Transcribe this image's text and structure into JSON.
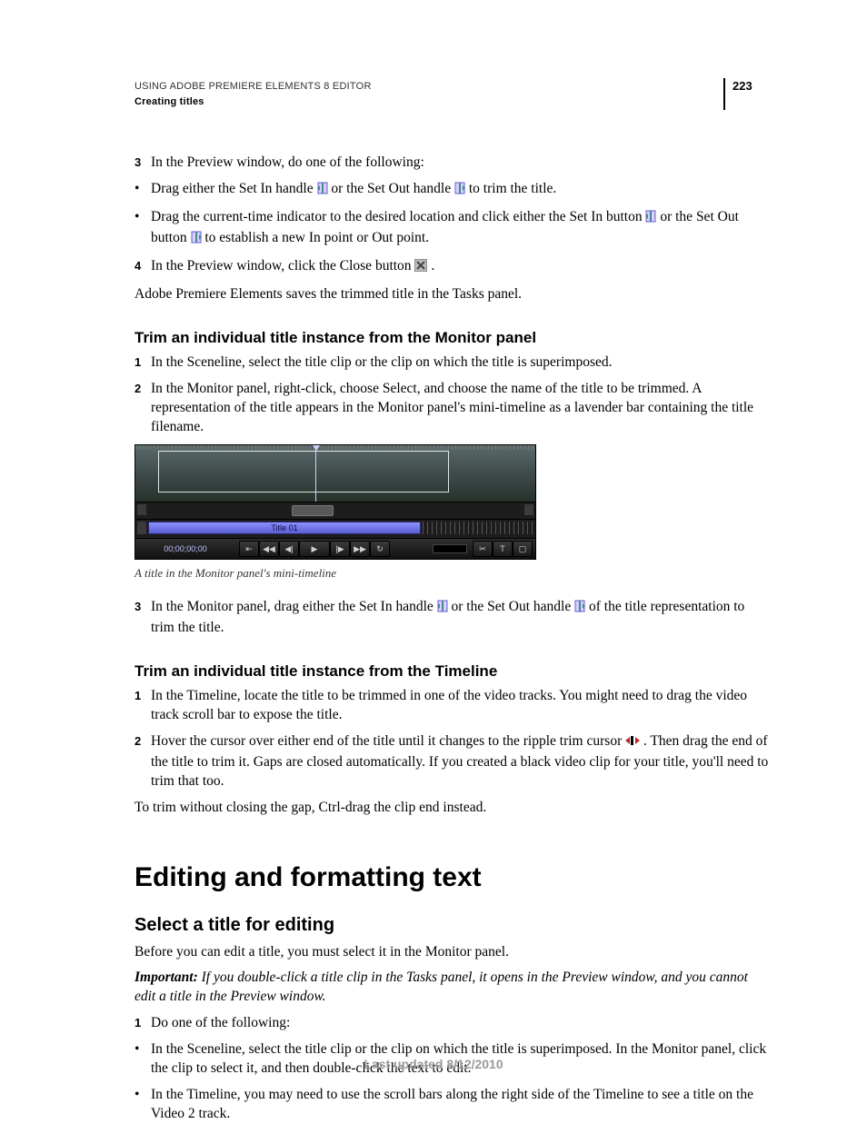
{
  "header": {
    "doc_title": "USING ADOBE PREMIERE ELEMENTS 8 EDITOR",
    "section": "Creating titles",
    "page_number": "223"
  },
  "content": {
    "intro_steps": [
      {
        "num": "3",
        "text": "In the Preview window, do one of the following:"
      }
    ],
    "intro_bullets": [
      {
        "pre": "Drag either the Set In handle ",
        "mid": " or the Set Out handle ",
        "post": " to trim the title."
      },
      {
        "pre": "Drag the current-time indicator to the desired location and click either the Set In button ",
        "mid": " or the Set Out button ",
        "post": " to establish a new In point or Out point."
      }
    ],
    "intro_steps2": [
      {
        "num": "4",
        "pre": "In the Preview window, click the Close button ",
        "post": "."
      }
    ],
    "intro_tail": "Adobe Premiere Elements saves the trimmed title in the Tasks panel.",
    "sectA_title": "Trim an individual title instance from the Monitor panel",
    "sectA_steps": [
      {
        "num": "1",
        "text": "In the Sceneline, select the title clip or the clip on which the title is superimposed."
      },
      {
        "num": "2",
        "text": "In the Monitor panel, right-click, choose Select, and choose the name of the title to be trimmed. A representation of the title appears in the Monitor panel's mini-timeline as a lavender bar containing the title filename."
      }
    ],
    "figure_caption": "A title in the Monitor panel's mini-timeline",
    "sectA_steps2": [
      {
        "num": "3",
        "pre": " In the Monitor panel, drag either the Set In handle ",
        "mid": " or the Set Out handle ",
        "post": " of the title representation to trim the title."
      }
    ],
    "sectB_title": "Trim an individual title instance from the Timeline",
    "sectB_steps": [
      {
        "num": "1",
        "text": "In the Timeline, locate the title to be trimmed in one of the video tracks. You might need to drag the video track scroll bar to expose the title."
      },
      {
        "num": "2",
        "pre": "Hover the cursor over either end of the title until it changes to the ripple trim cursor ",
        "post": ". Then drag the end of the title to trim it. Gaps are closed automatically. If you created a black video clip for your title, you'll need to trim that too."
      }
    ],
    "sectB_tail": "To trim without closing the gap, Ctrl-drag the clip end instead.",
    "chapter_title": "Editing and formatting text",
    "sectC_title": "Select a title for editing",
    "sectC_intro": "Before you can edit a title, you must select it in the Monitor panel.",
    "sectC_important_label": "Important: ",
    "sectC_important_body": "If you double-click a title clip in the Tasks panel, it opens in the Preview window, and you cannot edit a title in the Preview window.",
    "sectC_steps": [
      {
        "num": "1",
        "text": "Do one of the following:"
      }
    ],
    "sectC_bullets": [
      "In the Sceneline, select the title clip or the clip on which the title is superimposed. In the Monitor panel, click the clip to select it, and then double-click the text to edit.",
      "In the Timeline, you may need to use the scroll bars along the right side of the Timeline to see a title on the Video 2 track."
    ]
  },
  "monitor": {
    "title_bar": "Title 01",
    "timecode": "00;00;00;00"
  },
  "footer": "Last updated 8/12/2010"
}
